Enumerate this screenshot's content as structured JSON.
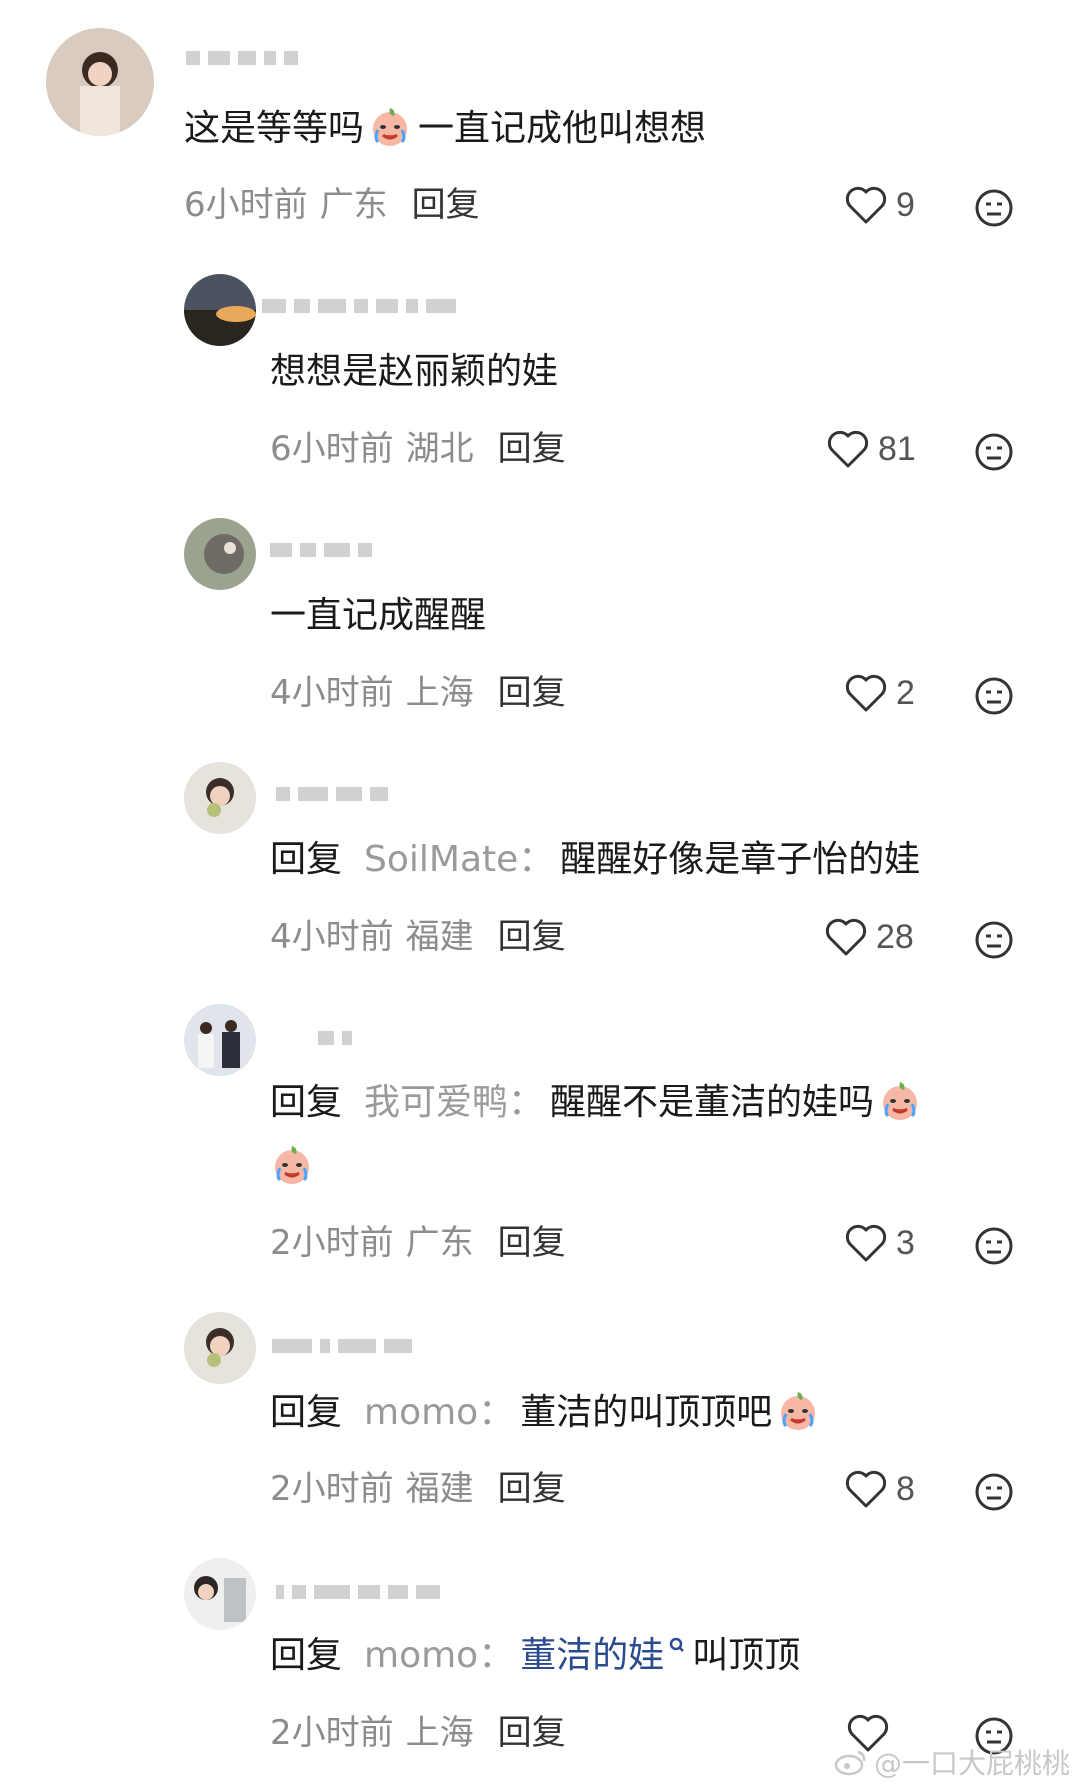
{
  "comments": [
    {
      "text": "这是等等吗",
      "text_after": "一直记成他叫想想",
      "time": "6小时前",
      "location": "广东",
      "reply_label": "回复",
      "likes": "9"
    },
    {
      "text": "想想是赵丽颖的娃",
      "time": "6小时前",
      "location": "湖北",
      "reply_label": "回复",
      "likes": "81"
    },
    {
      "text": "一直记成醒醒",
      "time": "4小时前",
      "location": "上海",
      "reply_label": "回复",
      "likes": "2"
    },
    {
      "reply_prefix": "回复",
      "target": "SoilMate：",
      "text": "醒醒好像是章子怡的娃",
      "time": "4小时前",
      "location": "福建",
      "reply_label": "回复",
      "likes": "28"
    },
    {
      "reply_prefix": "回复",
      "target": "我可爱鸭：",
      "text": "醒醒不是董洁的娃吗",
      "time": "2小时前",
      "location": "广东",
      "reply_label": "回复",
      "likes": "3"
    },
    {
      "reply_prefix": "回复",
      "target": "momo：",
      "text": "董洁的叫顶顶吧",
      "time": "2小时前",
      "location": "福建",
      "reply_label": "回复",
      "likes": "8"
    },
    {
      "reply_prefix": "回复",
      "target": "momo：",
      "link_text": "董洁的娃",
      "text": "叫顶顶",
      "time": "2小时前",
      "location": "上海",
      "reply_label": "回复",
      "likes": ""
    }
  ],
  "watermark": "@一口大屁桃桃",
  "colors": {
    "meta": "#8c8c8c",
    "link": "#2a4b8d",
    "icon": "#333333"
  }
}
